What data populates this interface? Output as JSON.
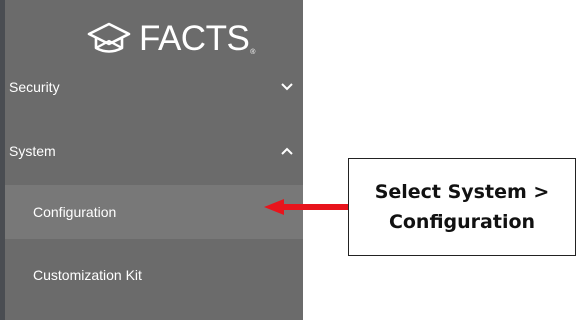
{
  "logo": {
    "text": "FACTS",
    "mark": "®",
    "icon": "graduation-cap-icon"
  },
  "sidebar": {
    "items": [
      {
        "label": "Security",
        "chevron": "chevron-down-icon",
        "expanded": false
      },
      {
        "label": "System",
        "chevron": "chevron-up-icon",
        "expanded": true
      },
      {
        "label": "Configuration",
        "selected": true
      },
      {
        "label": "Customization Kit"
      }
    ]
  },
  "callout": {
    "line1": "Select System >",
    "line2": "Configuration"
  },
  "colors": {
    "sidebar_bg": "#6b6b6b",
    "selected_bg": "#787878",
    "arrow": "#e8141c",
    "text": "#ffffff"
  }
}
